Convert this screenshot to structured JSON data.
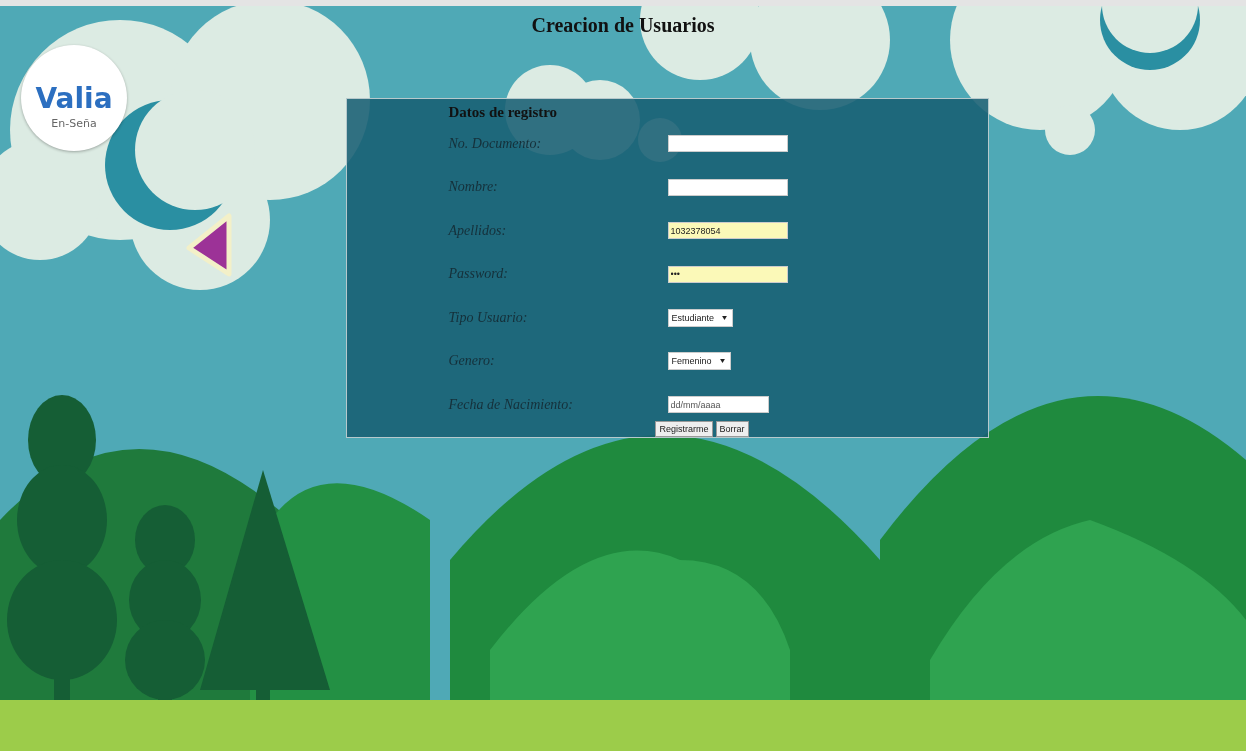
{
  "logo": {
    "name": "Valia",
    "tagline": "En-Seña"
  },
  "page_title": "Creacion de Usuarios",
  "form": {
    "heading": "Datos de registro",
    "fields": [
      {
        "kind": "text",
        "label": "No. Documento:",
        "autofilled": false
      },
      {
        "kind": "text",
        "label": "Nombre:",
        "autofilled": false
      },
      {
        "kind": "text",
        "label": "Apellidos:",
        "value": "1032378054",
        "autofilled": true
      },
      {
        "kind": "text",
        "label": "Password:",
        "value": "•••",
        "autofilled": true
      },
      {
        "kind": "select",
        "label": "Tipo Usuario:",
        "value": "Estudiante",
        "autofilled": false
      },
      {
        "kind": "select",
        "label": "Genero:",
        "value": "Femenino",
        "autofilled": false
      },
      {
        "kind": "date",
        "label": "Fecha de Nacimiento:",
        "placeholder": "dd/mm/aaaa",
        "autofilled": false
      }
    ],
    "buttons": [
      "Registrarme",
      "Borrar"
    ]
  }
}
